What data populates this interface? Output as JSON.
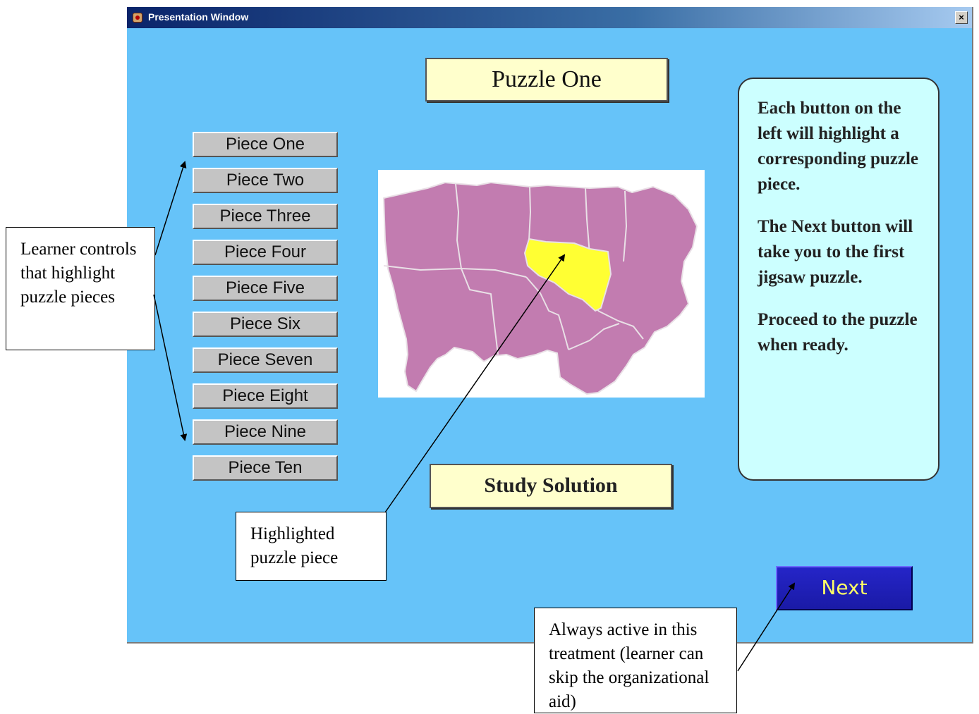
{
  "window": {
    "title": "Presentation Window",
    "close_glyph": "×",
    "app_icon": "app-icon"
  },
  "puzzle_title": "Puzzle One",
  "piece_buttons": [
    "Piece One",
    "Piece Two",
    "Piece Three",
    "Piece Four",
    "Piece Five",
    "Piece Six",
    "Piece Seven",
    "Piece Eight",
    "Piece Nine",
    "Piece Ten"
  ],
  "info": {
    "paragraph1": "Each button on the left will highlight a corresponding puzzle piece.",
    "paragraph2": "The Next button will take you to the first jigsaw puzzle.",
    "paragraph3": "Proceed to the puzzle when ready."
  },
  "study_button": "Study Solution",
  "next_button": "Next",
  "map": {
    "base_color": "#c27cb0",
    "highlight_color": "#ffff33",
    "border_color": "#e9e0e6"
  },
  "callouts": {
    "learner_controls": "Learner controls that highlight puzzle pieces",
    "highlighted_piece": "Highlighted puzzle piece",
    "always_active": "Always active in this treatment (learner can skip the organizational aid)"
  },
  "colors": {
    "window_bg": "#66c3f9",
    "label_bg": "#ffffcc",
    "info_bg": "#ccffff",
    "next_bg": "#1f1fbb"
  }
}
